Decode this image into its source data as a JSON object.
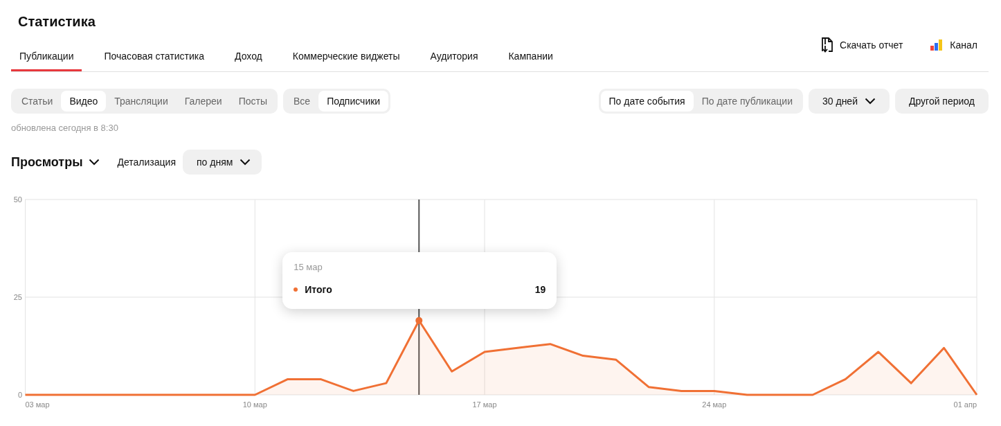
{
  "page_title": "Статистика",
  "tabs": [
    {
      "label": "Публикации",
      "selected": true
    },
    {
      "label": "Почасовая статистика",
      "selected": false
    },
    {
      "label": "Доход",
      "selected": false
    },
    {
      "label": "Коммерческие виджеты",
      "selected": false
    },
    {
      "label": "Аудитория",
      "selected": false
    },
    {
      "label": "Кампании",
      "selected": false
    }
  ],
  "actions": [
    {
      "kind": "download",
      "label": "Скачать отчет"
    },
    {
      "kind": "channel",
      "label": "Канал"
    }
  ],
  "content_filter": [
    {
      "label": "Статьи",
      "selected": false
    },
    {
      "label": "Видео",
      "selected": true
    },
    {
      "label": "Трансляции",
      "selected": false
    },
    {
      "label": "Галереи",
      "selected": false
    },
    {
      "label": "Посты",
      "selected": false
    }
  ],
  "audience_filter": [
    {
      "label": "Все",
      "selected": false
    },
    {
      "label": "Подписчики",
      "selected": true
    }
  ],
  "date_mode": [
    {
      "label": "По дате события",
      "selected": true
    },
    {
      "label": "По дате публикации",
      "selected": false
    }
  ],
  "period_dropdown": "30 дней",
  "custom_period_button": "Другой период",
  "updated_note": "обновлена сегодня в 8:30",
  "metric_dropdown": "Просмотры",
  "detail_label": "Детализация",
  "detail_dropdown": "по дням",
  "chart": {
    "chart_data": {
      "type": "area",
      "categories": [
        "03 мар",
        null,
        null,
        null,
        null,
        null,
        null,
        "10 мар",
        null,
        null,
        null,
        null,
        null,
        null,
        "17 мар",
        null,
        null,
        null,
        null,
        null,
        null,
        "24 мар",
        null,
        null,
        null,
        null,
        null,
        null,
        null,
        "01 апр"
      ],
      "series": [
        {
          "name": "Итого",
          "color": "#f07034",
          "values": [
            0,
            0,
            0,
            0,
            0,
            0,
            0,
            0,
            4,
            4,
            1,
            3,
            19,
            6,
            11,
            12,
            13,
            10,
            9,
            2,
            1,
            1,
            0,
            0,
            0,
            4,
            11,
            3,
            12,
            0
          ]
        }
      ],
      "ylim": [
        0,
        50
      ],
      "yticks": [
        0,
        25,
        50
      ],
      "grid": true
    },
    "cursor": {
      "level": 0.4138
    },
    "tooltip": {
      "date": "15 мар",
      "value": "19"
    }
  }
}
